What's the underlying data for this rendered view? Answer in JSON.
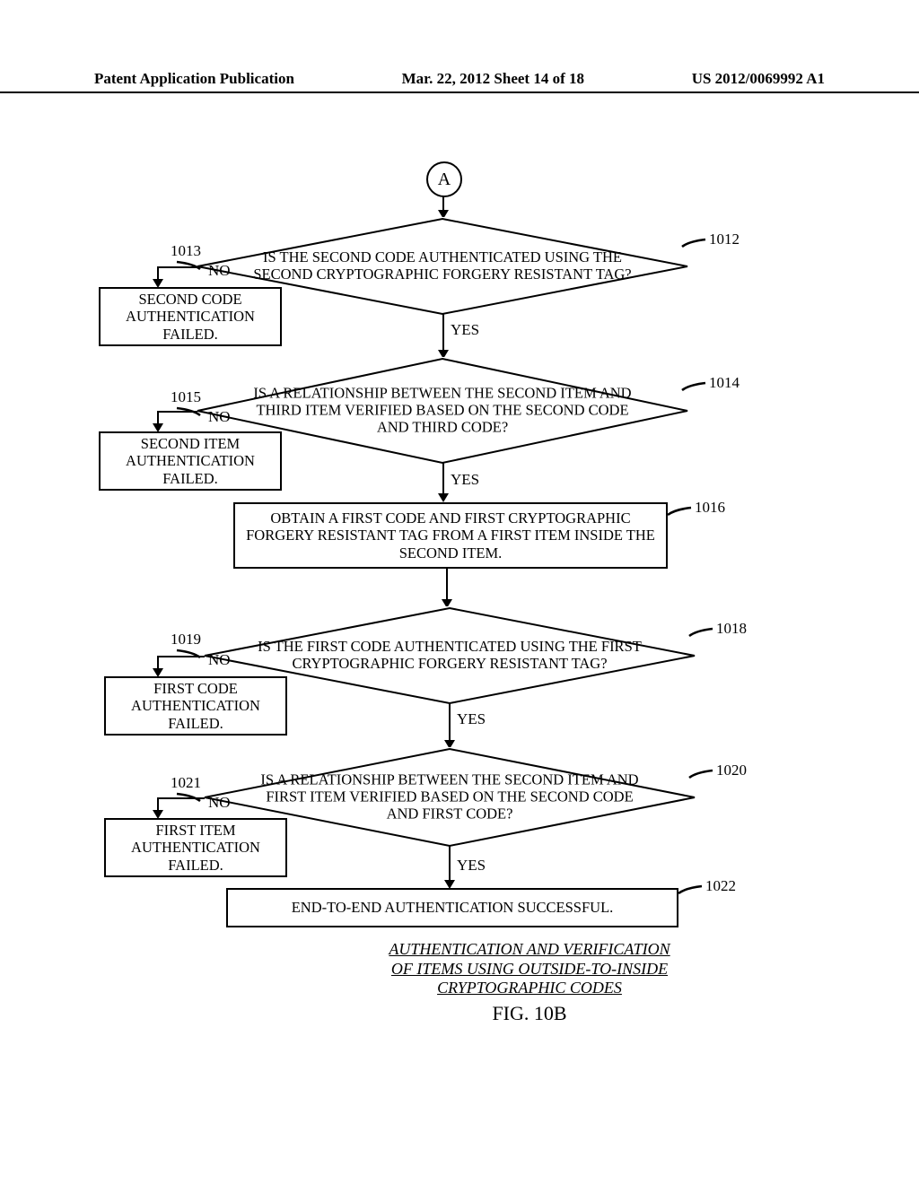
{
  "header": {
    "left": "Patent Application Publication",
    "center": "Mar. 22, 2012  Sheet 14 of 18",
    "right": "US 2012/0069992 A1"
  },
  "flow": {
    "connector": "A",
    "d1012_text": "IS THE SECOND CODE AUTHENTICATED USING THE SECOND CRYPTOGRAPHIC FORGERY RESISTANT TAG?",
    "d1012_ref": "1012",
    "r1013_text": "SECOND CODE AUTHENTICATION FAILED.",
    "r1013_ref": "1013",
    "d1014_text": "IS A RELATIONSHIP BETWEEN THE SECOND ITEM AND THIRD ITEM VERIFIED BASED ON THE SECOND CODE AND THIRD CODE?",
    "d1014_ref": "1014",
    "r1015_text": "SECOND ITEM AUTHENTICATION FAILED.",
    "r1015_ref": "1015",
    "r1016_text": "OBTAIN A FIRST CODE AND FIRST CRYPTOGRAPHIC FORGERY RESISTANT TAG FROM A FIRST ITEM INSIDE THE SECOND ITEM.",
    "r1016_ref": "1016",
    "d1018_text": "IS THE FIRST CODE AUTHENTICATED USING THE FIRST CRYPTOGRAPHIC FORGERY RESISTANT TAG?",
    "d1018_ref": "1018",
    "r1019_text": "FIRST CODE AUTHENTICATION FAILED.",
    "r1019_ref": "1019",
    "d1020_text": "IS A RELATIONSHIP BETWEEN THE SECOND ITEM AND FIRST ITEM VERIFIED BASED ON THE SECOND CODE AND FIRST CODE?",
    "d1020_ref": "1020",
    "r1021_text": "FIRST ITEM AUTHENTICATION FAILED.",
    "r1021_ref": "1021",
    "r1022_text": "END-TO-END AUTHENTICATION SUCCESSFUL.",
    "r1022_ref": "1022",
    "yes": "YES",
    "no": "NO"
  },
  "caption": {
    "title_l1": "AUTHENTICATION AND VERIFICATION",
    "title_l2": "OF ITEMS USING OUTSIDE-TO-INSIDE",
    "title_l3": "CRYPTOGRAPHIC CODES",
    "fig": "FIG. 10B"
  }
}
